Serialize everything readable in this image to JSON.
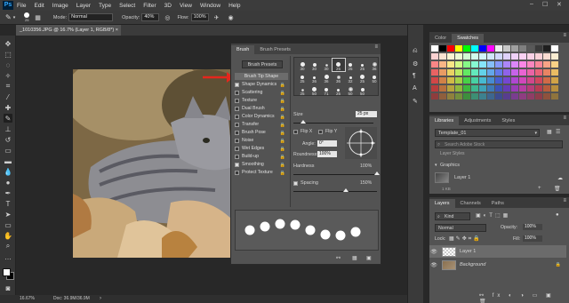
{
  "app": {
    "logo": "Ps"
  },
  "menu": [
    "File",
    "Edit",
    "Image",
    "Layer",
    "Type",
    "Select",
    "Filter",
    "3D",
    "View",
    "Window",
    "Help"
  ],
  "options": {
    "brush_size": "25",
    "mode_label": "Mode:",
    "mode_value": "Normal",
    "opacity_label": "Opacity:",
    "opacity_value": "40%",
    "flow_label": "Flow:",
    "flow_value": "100%"
  },
  "document": {
    "tab_title": "_1010356.JPG @ 16.7% (Layer 1, RGB/8*) ×",
    "zoom": "16.67%",
    "doc_info": "Doc: 36.9M/36.9M"
  },
  "brush_panel": {
    "tabs": [
      "Brush",
      "Brush Presets"
    ],
    "presets_button": "Brush Presets",
    "options": [
      {
        "label": "Brush Tip Shape",
        "checked": null,
        "active": true
      },
      {
        "label": "Shape Dynamics",
        "checked": true
      },
      {
        "label": "Scattering",
        "checked": false
      },
      {
        "label": "Texture",
        "checked": false
      },
      {
        "label": "Dual Brush",
        "checked": false
      },
      {
        "label": "Color Dynamics",
        "checked": false
      },
      {
        "label": "Transfer",
        "checked": false
      },
      {
        "label": "Brush Pose",
        "checked": false
      },
      {
        "label": "Noise",
        "checked": false
      },
      {
        "label": "Wet Edges",
        "checked": false
      },
      {
        "label": "Build-up",
        "checked": false
      },
      {
        "label": "Smoothing",
        "checked": true
      },
      {
        "label": "Protect Texture",
        "checked": false
      }
    ],
    "tip_sizes": [
      "30",
      "30",
      "30",
      "25",
      "25",
      "25",
      "36",
      "25",
      "36",
      "36",
      "36",
      "32",
      "25",
      "50",
      "25",
      "50",
      "71",
      "25",
      "50",
      "50"
    ],
    "size_label": "Size",
    "size_value": "25 px",
    "flip_x": "Flip X",
    "flip_y": "Flip Y",
    "angle_label": "Angle:",
    "angle_value": "0°",
    "roundness_label": "Roundness:",
    "roundness_value": "100%",
    "hardness_label": "Hardness",
    "hardness_value": "100%",
    "spacing_label": "Spacing",
    "spacing_value": "150%"
  },
  "color_panel": {
    "tabs": [
      "Color",
      "Swatches"
    ]
  },
  "libraries_panel": {
    "tabs": [
      "Libraries",
      "Adjustments",
      "Styles"
    ],
    "library": "Template_01",
    "search_placeholder": "Search Adobe Stock",
    "layer_styles": "Layer Styles",
    "graphics": "Graphics",
    "graphic_item": "Layer 1",
    "kb": "1 KB"
  },
  "layers_panel": {
    "tabs": [
      "Layers",
      "Channels",
      "Paths"
    ],
    "kind": "Kind",
    "blend_mode": "Normal",
    "opacity_label": "Opacity:",
    "opacity_value": "100%",
    "lock_label": "Lock:",
    "fill_label": "Fill:",
    "fill_value": "100%",
    "layers": [
      {
        "name": "Layer 1",
        "selected": true
      },
      {
        "name": "Background",
        "selected": false
      }
    ]
  },
  "colors": {
    "accent": "#e5261d",
    "panel_bg": "#535353"
  }
}
